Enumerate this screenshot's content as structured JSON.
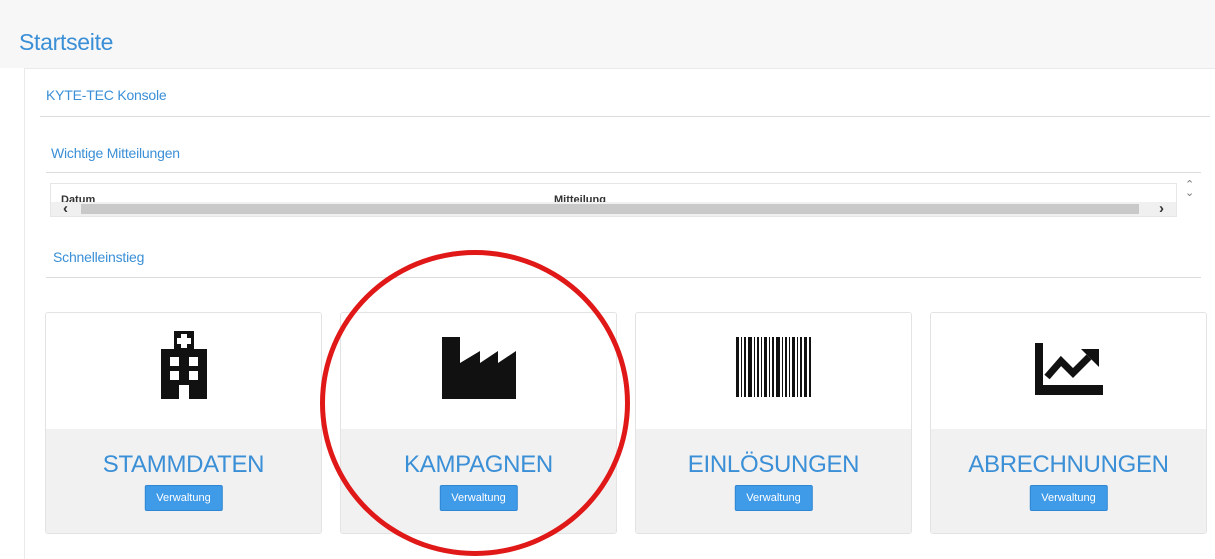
{
  "page": {
    "title": "Startseite"
  },
  "panel": {
    "heading": "KYTE-TEC Konsole"
  },
  "messages": {
    "title": "Wichtige Mitteilungen",
    "columns": [
      "Datum",
      "Mitteilung"
    ]
  },
  "quick": {
    "title": "Schnelleinstieg"
  },
  "cards": [
    {
      "title": "STAMMDATEN",
      "button": "Verwaltung",
      "icon": "hospital-building-icon"
    },
    {
      "title": "KAMPAGNEN",
      "button": "Verwaltung",
      "icon": "factory-icon"
    },
    {
      "title": "EINLÖSUNGEN",
      "button": "Verwaltung",
      "icon": "barcode-icon"
    },
    {
      "title": "ABRECHNUNGEN",
      "button": "Verwaltung",
      "icon": "chart-line-icon"
    }
  ],
  "annotation": {
    "color": "#e01818",
    "highlighted": "KAMPAGNEN"
  },
  "colors": {
    "accent": "#3a8fd6",
    "button": "#3f9ae8"
  }
}
